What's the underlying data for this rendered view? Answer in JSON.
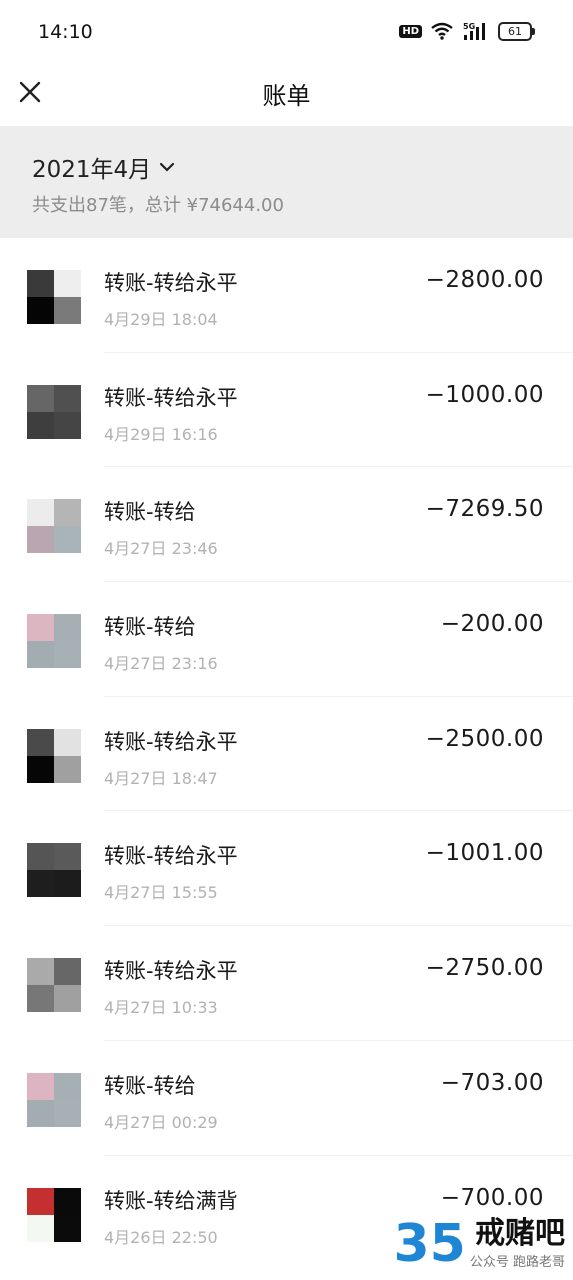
{
  "status_bar": {
    "time": "14:10",
    "network": "5G",
    "battery": "61"
  },
  "header": {
    "title": "账单"
  },
  "summary": {
    "month": "2021年4月",
    "text": "共支出87笔，总计 ¥74644.00"
  },
  "transactions": [
    {
      "title": "转账-转给永平",
      "time": "4月29日 18:04",
      "amount": "−2800.00",
      "avatar_colors": [
        "#3a3a3a",
        "#eeeeee",
        "#050505",
        "#7a7a7a"
      ]
    },
    {
      "title": "转账-转给永平",
      "time": "4月29日 16:16",
      "amount": "−1000.00",
      "avatar_colors": [
        "#666666",
        "#505050",
        "#3e3e3e",
        "#454545"
      ]
    },
    {
      "title": "转账-转给",
      "time": "4月27日 23:46",
      "amount": "−7269.50",
      "avatar_colors": [
        "#ececec",
        "#b5b5b5",
        "#b9a6b1",
        "#a9b4b8"
      ]
    },
    {
      "title": "转账-转给",
      "time": "4月27日 23:16",
      "amount": "−200.00",
      "avatar_colors": [
        "#dcb7c1",
        "#a6b0b4",
        "#a3adb1",
        "#a7b1b5"
      ]
    },
    {
      "title": "转账-转给永平",
      "time": "4月27日 18:47",
      "amount": "−2500.00",
      "avatar_colors": [
        "#4a4a4a",
        "#e2e2e2",
        "#060606",
        "#a0a0a0"
      ]
    },
    {
      "title": "转账-转给永平",
      "time": "4月27日 15:55",
      "amount": "−1001.00",
      "avatar_colors": [
        "#555555",
        "#5a5a5a",
        "#1e1e1e",
        "#1c1c1c"
      ]
    },
    {
      "title": "转账-转给永平",
      "time": "4月27日 10:33",
      "amount": "−2750.00",
      "avatar_colors": [
        "#aaaaaa",
        "#676767",
        "#777777",
        "#a0a0a0"
      ]
    },
    {
      "title": "转账-转给",
      "time": "4月27日 00:29",
      "amount": "−703.00",
      "avatar_colors": [
        "#dcb4c2",
        "#a6b0b4",
        "#a3adb1",
        "#a7b1b5"
      ]
    },
    {
      "title": "转账-转给满背",
      "time": "4月26日 22:50",
      "amount": "−700.00",
      "avatar_colors": [
        "#c4302f",
        "#0a0a0a",
        "#f3f8f3",
        "#0b0b0b"
      ]
    }
  ],
  "watermark": {
    "logo": "35",
    "brand": "戒赌吧",
    "sub": "公众号 跑路老哥"
  }
}
